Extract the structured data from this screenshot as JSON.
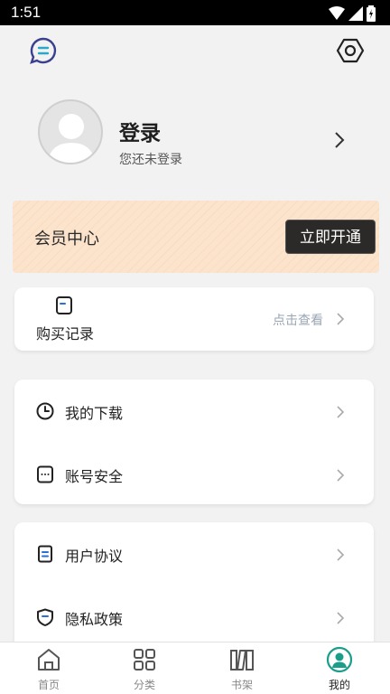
{
  "status_bar": {
    "time": "1:51"
  },
  "profile": {
    "title": "登录",
    "subtitle": "您还未登录"
  },
  "vip": {
    "title": "会员中心",
    "button_label": "立即开通"
  },
  "purchase": {
    "label": "购买记录",
    "link_text": "点击查看"
  },
  "menu_group_1": [
    {
      "label": "我的下载",
      "icon": "clock-icon"
    },
    {
      "label": "账号安全",
      "icon": "keyboard-icon"
    }
  ],
  "menu_group_2": [
    {
      "label": "用户协议",
      "icon": "document-icon"
    },
    {
      "label": "隐私政策",
      "icon": "shield-icon"
    }
  ],
  "tabs": [
    {
      "label": "首页",
      "icon": "home-icon",
      "active": false
    },
    {
      "label": "分类",
      "icon": "grid-icon",
      "active": false
    },
    {
      "label": "书架",
      "icon": "bookshelf-icon",
      "active": false
    },
    {
      "label": "我的",
      "icon": "user-icon",
      "active": true
    }
  ],
  "colors": {
    "accent": "#1a9e8a",
    "vip_bg": "#fbe3cc",
    "vip_button": "#2b2a28",
    "link": "#9aa6b5"
  }
}
